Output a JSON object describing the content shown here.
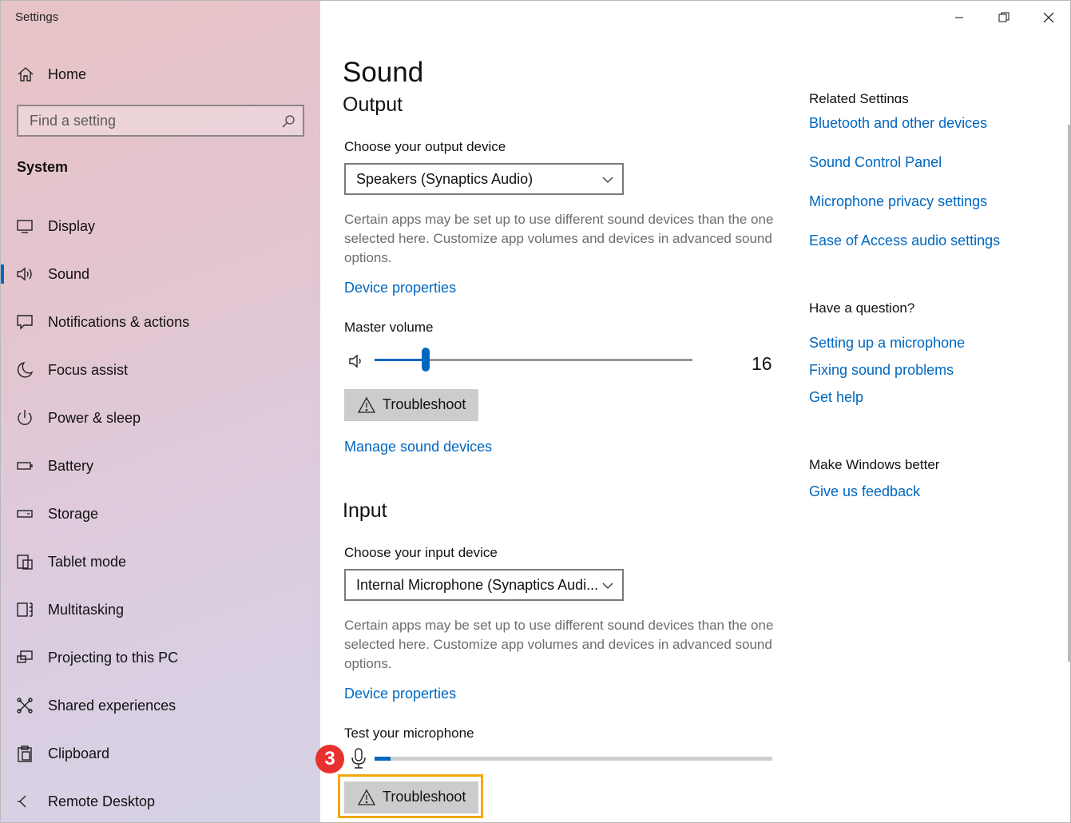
{
  "window": {
    "title": "Settings"
  },
  "sidebar": {
    "home": "Home",
    "search_placeholder": "Find a setting",
    "section": "System",
    "items": [
      {
        "label": "Display",
        "icon": "monitor-icon"
      },
      {
        "label": "Sound",
        "icon": "speaker-icon",
        "active": true
      },
      {
        "label": "Notifications & actions",
        "icon": "notification-icon"
      },
      {
        "label": "Focus assist",
        "icon": "moon-icon"
      },
      {
        "label": "Power & sleep",
        "icon": "power-icon"
      },
      {
        "label": "Battery",
        "icon": "battery-icon"
      },
      {
        "label": "Storage",
        "icon": "storage-icon"
      },
      {
        "label": "Tablet mode",
        "icon": "tablet-mode-icon"
      },
      {
        "label": "Multitasking",
        "icon": "multitasking-icon"
      },
      {
        "label": "Projecting to this PC",
        "icon": "projecting-icon"
      },
      {
        "label": "Shared experiences",
        "icon": "shared-icon"
      },
      {
        "label": "Clipboard",
        "icon": "clipboard-icon"
      },
      {
        "label": "Remote Desktop",
        "icon": "remote-desktop-icon"
      }
    ]
  },
  "main": {
    "title": "Sound",
    "output": {
      "heading": "Output",
      "device_label": "Choose your output device",
      "device_value": "Speakers (Synaptics Audio)",
      "description": "Certain apps may be set up to use different sound devices than the one selected here. Customize app volumes and devices in advanced sound options.",
      "device_properties": "Device properties",
      "volume_label": "Master volume",
      "volume_value": "16",
      "volume_level": 0.16,
      "troubleshoot": "Troubleshoot",
      "manage_devices": "Manage sound devices"
    },
    "input": {
      "heading": "Input",
      "device_label": "Choose your input device",
      "device_value": "Internal Microphone (Synaptics Audi...",
      "description": "Certain apps may be set up to use different sound devices than the one selected here. Customize app volumes and devices in advanced sound options.",
      "device_properties": "Device properties",
      "test_label": "Test your microphone",
      "mic_level": 0.04,
      "troubleshoot": "Troubleshoot"
    },
    "step_badge": "3",
    "accent": "#0067c0",
    "highlight_color": "#f2a80b"
  },
  "related": {
    "heading": "Related Settings",
    "links": [
      "Bluetooth and other devices",
      "Sound Control Panel",
      "Microphone privacy settings",
      "Ease of Access audio settings"
    ],
    "question_heading": "Have a question?",
    "question_links": [
      "Setting up a microphone",
      "Fixing sound problems",
      "Get help"
    ],
    "better_heading": "Make Windows better",
    "feedback": "Give us feedback"
  }
}
